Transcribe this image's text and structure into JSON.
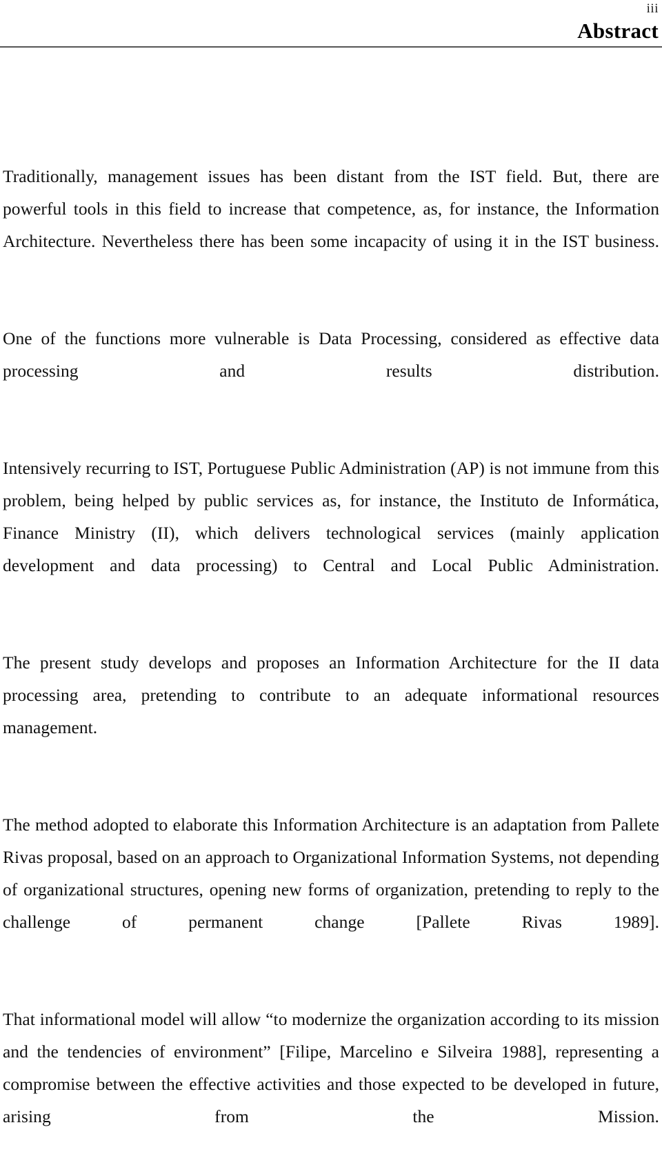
{
  "header": {
    "folio": "iii",
    "title": "Abstract"
  },
  "body": {
    "paragraphs": [
      "Traditionally, management issues has been distant from the IST field. But, there are powerful tools in this field to increase that competence, as, for instance, the Information Architecture. Nevertheless there has been some incapacity of using it in the IST business.",
      "One of the functions more vulnerable is Data Processing, considered as effective data processing and results distribution.",
      "Intensively recurring to IST, Portuguese Public Administration (AP) is not immune from this problem, being helped by public services as, for instance, the Instituto de Informática, Finance Ministry (II), which delivers technological services (mainly application development and data processing) to Central and Local Public Administration.",
      "The present study develops and proposes an Information Architecture for the II data processing area, pretending to contribute to an adequate informational resources management.",
      "The method adopted to elaborate this Information Architecture is an adaptation from Pallete Rivas proposal, based on an approach to Organizational Information Systems, not depending of organizational structures, opening new forms of organization, pretending to reply to the challenge of permanent change [Pallete Rivas 1989].",
      "That informational model will allow “to modernize the organization according to its mission and the tendencies of environment” [Filipe, Marcelino e Silveira 1988], representing a compromise between the effective activities and those expected to be developed in future, arising from the Mission."
    ]
  }
}
